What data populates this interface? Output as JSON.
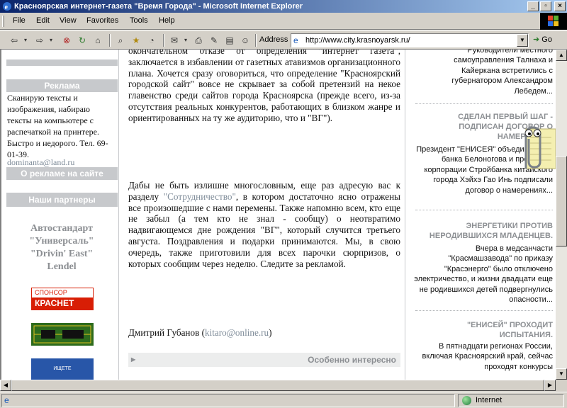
{
  "window": {
    "title": "Красноярская интернет-газета \"Время Города\" - Microsoft Internet Explorer",
    "min_glyph": "_",
    "max_glyph": "▫",
    "close_glyph": "×"
  },
  "menu": [
    "File",
    "Edit",
    "View",
    "Favorites",
    "Tools",
    "Help"
  ],
  "toolbar": {
    "address_label": "Address",
    "url": "http://www.city.krasnoyarsk.ru/",
    "go_label": "Go"
  },
  "left": {
    "ads_header": "Реклама",
    "ad_text": "Сканирую тексты и изображения, набираю тексты на компьютере с распечаткой на принтере. Быстро и недорого. Тел. 69-01-39.",
    "ad_email": "dominanta@land.ru",
    "about_ads": "О рекламе на сайте",
    "partners_header": "Наши партнеры",
    "partners": [
      "Автостандарт",
      "\"Универсаль\"",
      "\"Drivin' East\"",
      "Lendel"
    ],
    "banner1_top": "СПОНСОР",
    "banner1_bottom": "КРАСНЕТ",
    "banner3_text": "ИЩЕТЕ КОМПЛЕКТУЮЩИЕ?"
  },
  "main": {
    "p1": "окончательном отказе от определения \"интернет газета\", заключается в избавлении от газетных атавизмов организационного плана. Хочется сразу оговориться, что определение \"Красноярский городской сайт\" вовсе не скрывает за собой претензий на некое главенство среди сайтов города Красноярска (прежде всего, из-за отсутствия реальных конкурентов, работающих в близком жанре и ориентированных на ту же аудиторию, что и \"ВГ\").",
    "p2_before": "Дабы не быть излишне многословным, еще раз адресую вас к разделу ",
    "p2_link": "\"Сотрудничество\"",
    "p2_after": ", в котором достаточно ясно отражены все произошедшие с нами перемены. Также напомню всем, кто еще не забыл (а тем кто не знал - сообщу) о неотвратимо надвигающемся дне рождения \"ВГ\", который случится третьего августа. Поздравления и подарки принимаются. Мы, в свою очередь, также приготовили для всех парочки сюрпризов, о которых сообщим через неделю. Следите за рекламой.",
    "signature_name": "Дмитрий Губанов (",
    "signature_email": "kitaro@online.ru",
    "signature_close": ")",
    "interesting": "Особенно интересно"
  },
  "right": {
    "n0_body": "Руководители местного самоуправления Талнаха и Кайеркана встретились с губернатором Александром Лебедем...",
    "n1_head": "СДЕЛАН ПЕРВЫЙ ШАГ - ПОДПИСАН ДОГОВОР О НАМЕРЕНИЯХ",
    "n1_body": "Президент \"ЕНИСЕЯ\" объединенного банка Белоногова и президент корпорации Стройбанка китайского города Хэйхэ Гао Инь подписали договор о намерениях...",
    "n2_head": "ЭНЕРГЕТИКИ ПРОТИВ НЕРОДИВШИХСЯ МЛАДЕНЦЕВ.",
    "n2_body": "Вчера в медсанчасти \"Красмашзавода\" по приказу \"Красэнерго\" было отключено электричество, и жизни двадцати еще не родившихся детей подвергнулись опасности...",
    "n3_head": "\"ЕНИСЕЙ\" ПРОХОДИТ ИСПЫТАНИЯ.",
    "n3_body": "В пятнадцати регионах России, включая Красноярский край, сейчас проходят конкурсы"
  },
  "status": {
    "zone": "Internet"
  },
  "colors": {
    "title_start": "#0a246a",
    "title_end": "#a6caf0",
    "gray_header": "#c7c9cc",
    "link_gray": "#7f8c99",
    "sponsor_red": "#d81e05"
  }
}
